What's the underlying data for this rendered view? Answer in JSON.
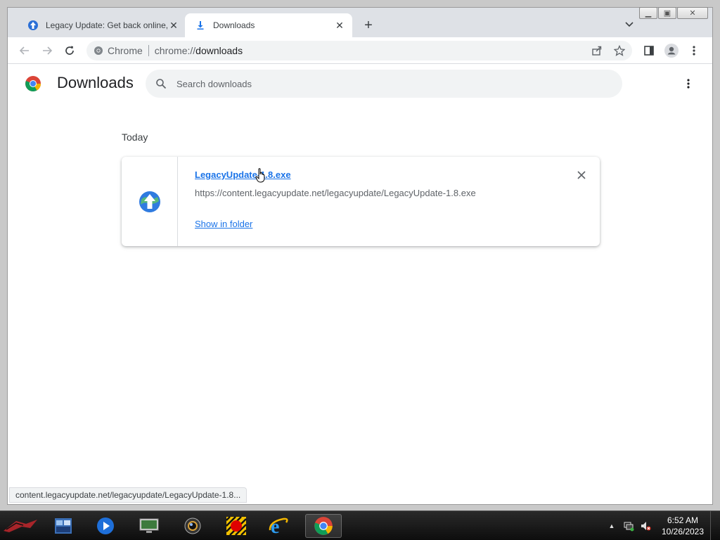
{
  "tabs": [
    {
      "label": "Legacy Update: Get back online,",
      "favicon": "globe-icon"
    },
    {
      "label": "Downloads",
      "favicon": "download-icon"
    }
  ],
  "omnibox": {
    "chip_label": "Chrome",
    "url_prefix": "chrome://",
    "url_path": "downloads"
  },
  "downloads_page": {
    "title": "Downloads",
    "search_placeholder": "Search downloads",
    "date_heading": "Today",
    "items": [
      {
        "filename": "LegacyUpdate-1.8.exe",
        "url": "https://content.legacyupdate.net/legacyupdate/LegacyUpdate-1.8.exe",
        "action": "Show in folder"
      }
    ]
  },
  "status_bar": {
    "text": "content.legacyupdate.net/legacyupdate/LegacyUpdate-1.8..."
  },
  "taskbar": {
    "apps": [
      "rog-start-icon",
      "explorer-icon",
      "media-player-icon",
      "remote-desktop-icon",
      "camera-icon",
      "record-icon",
      "ie-icon",
      "chrome-icon"
    ],
    "clock_time": "6:52 AM",
    "clock_date": "10/26/2023"
  },
  "colors": {
    "accent": "#1a73e8",
    "tabstrip": "#dee1e6",
    "taskbar": "#111111"
  }
}
